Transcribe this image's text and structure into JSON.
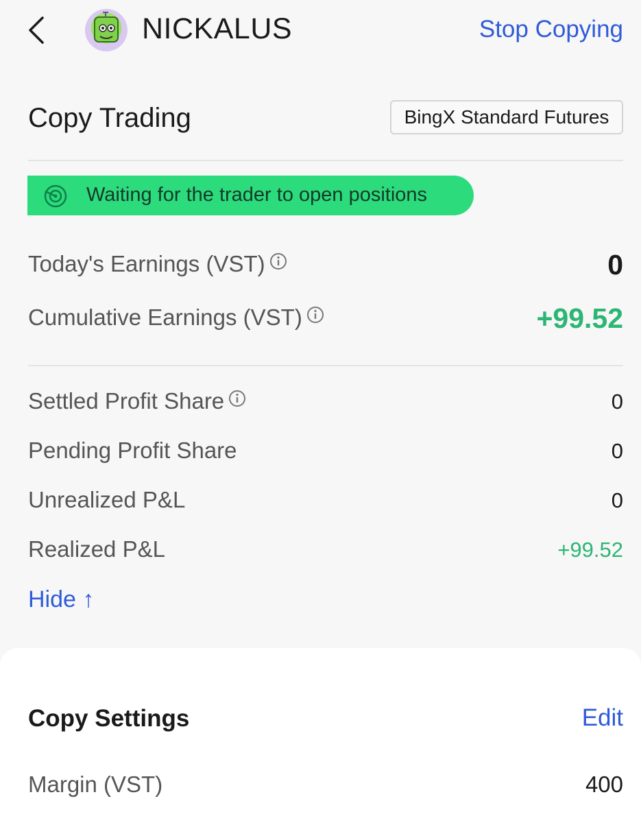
{
  "header": {
    "back_icon": "chevron-left-icon",
    "trader_name": "NICKALUS",
    "stop_copying_label": "Stop Copying"
  },
  "copy_trading": {
    "title": "Copy Trading",
    "account_type": "BingX Standard Futures",
    "status": "Waiting for the trader to open positions",
    "status_color": "#2bdb7c"
  },
  "earnings": [
    {
      "label": "Today's Earnings  (VST)",
      "value": "0",
      "has_info": true
    },
    {
      "label": "Cumulative Earnings  (VST)",
      "value": "+99.52",
      "has_info": true
    }
  ],
  "details": [
    {
      "label": "Settled Profit Share",
      "value": "0",
      "has_info": true
    },
    {
      "label": "Pending Profit Share",
      "value": "0",
      "has_info": false
    },
    {
      "label": "Unrealized P&L",
      "value": "0",
      "has_info": false
    },
    {
      "label": "Realized P&L",
      "value": "+99.52",
      "has_info": false
    }
  ],
  "hide_label": "Hide ↑",
  "copy_settings": {
    "title": "Copy Settings",
    "edit_label": "Edit",
    "margin_label": "Margin (VST)",
    "margin_value": "400"
  },
  "colors": {
    "accent_blue": "#2f5bd8",
    "profit_green": "#2bb673"
  }
}
